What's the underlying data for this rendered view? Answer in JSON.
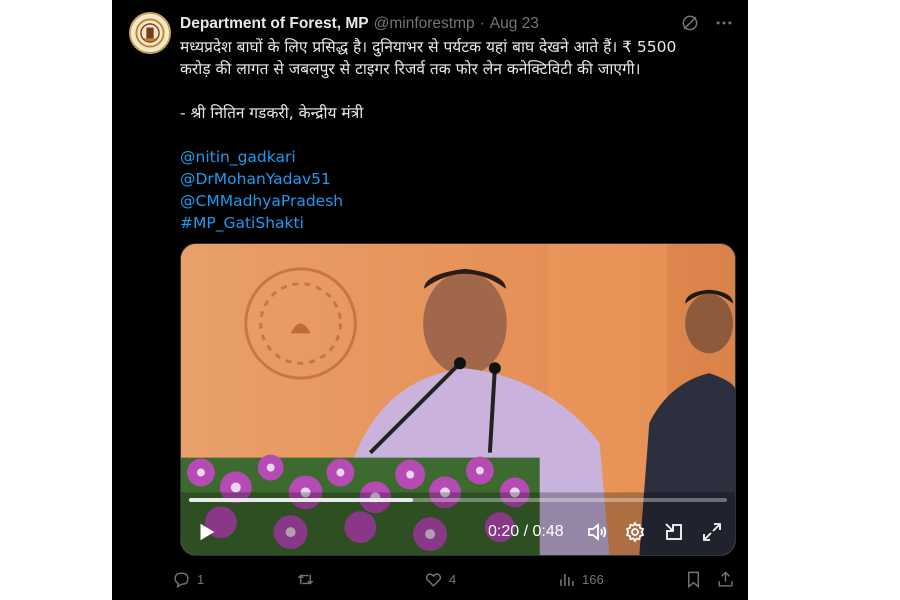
{
  "tweet": {
    "author_name": "Department of Forest, MP",
    "handle": "@minforestmp",
    "separator": "·",
    "date": "Aug 23",
    "text_lines": [
      "मध्यप्रदेश बाघों के लिए प्रसिद्ध है। दुनियाभर से पर्यटक यहां बाघ देखने आते हैं। ₹ 5500",
      "करोड़ की लागत से जबलपुर से टाइगर रिजर्व तक फोर लेन कनेक्टिविटी की जाएगी।",
      "",
      " - श्री नितिन गडकरी, केन्द्रीय मंत्री",
      ""
    ],
    "links": [
      "@nitin_gadkari",
      "@DrMohanYadav51",
      "@CMMadhyaPradesh",
      "#MP_GatiShakti"
    ]
  },
  "video": {
    "time_display": "0:20 / 0:48",
    "progress_fraction": 0.4167
  },
  "actions": {
    "reply_count": "1",
    "retweet_count": "",
    "like_count": "4",
    "views_count": "166"
  },
  "icons": {
    "top": [
      "grok-icon",
      "more-icon"
    ],
    "video": [
      "play-icon",
      "volume-icon",
      "settings-icon",
      "pip-icon",
      "fullscreen-icon"
    ],
    "actions": [
      "reply-icon",
      "retweet-icon",
      "like-icon",
      "views-icon",
      "bookmark-icon",
      "share-icon"
    ]
  },
  "colors": {
    "background": "#000000",
    "text": "#e7e9ea",
    "muted": "#71767b",
    "link": "#1d9bf0",
    "video_backdrop": "#e59157"
  }
}
